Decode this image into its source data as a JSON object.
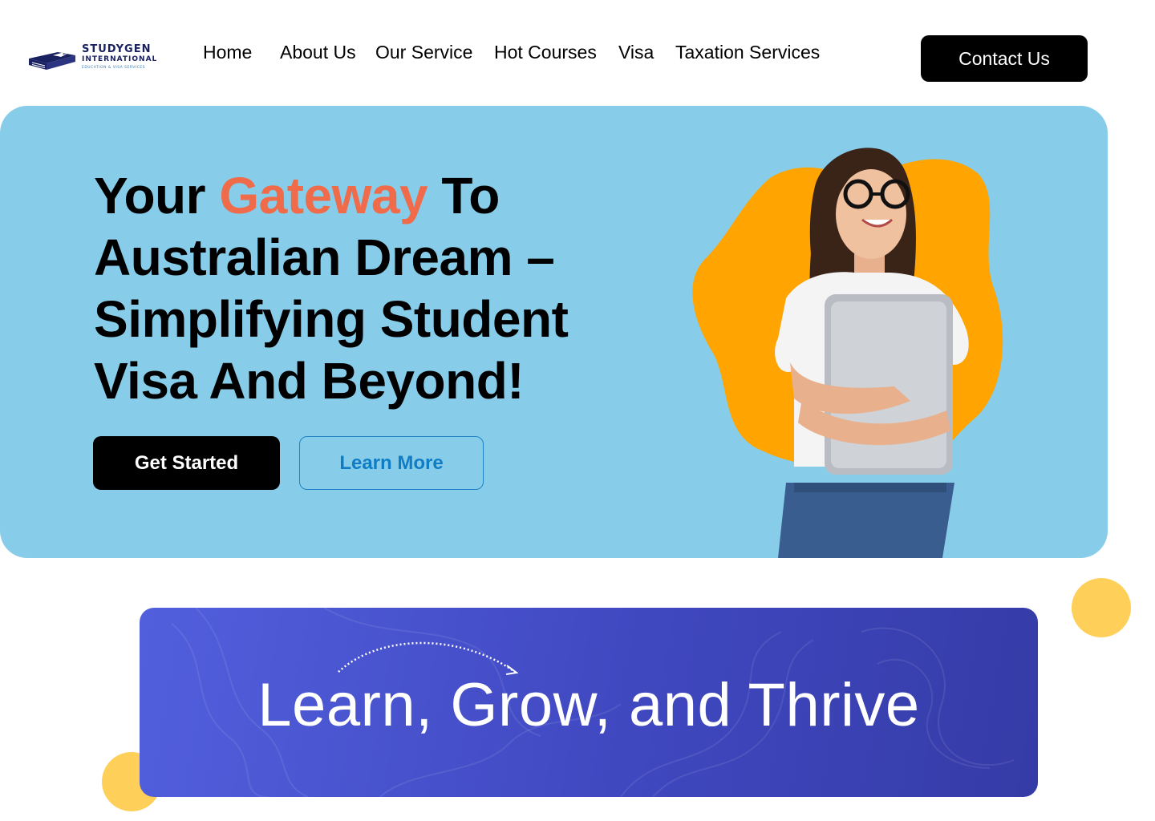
{
  "brand": {
    "name": "STUDYGEN",
    "sub": "INTERNATIONAL",
    "tagline": "Education & Visa Services",
    "icon": "book-plane-logo-icon"
  },
  "nav": {
    "items": [
      {
        "label": "Home"
      },
      {
        "label": "About Us"
      },
      {
        "label": "Our Service"
      },
      {
        "label": "Hot Courses"
      },
      {
        "label": "Visa"
      },
      {
        "label": "Taxation Services"
      }
    ],
    "contact_label": "Contact Us"
  },
  "hero": {
    "heading_part1": "Your ",
    "heading_accent": "Gateway",
    "heading_part2": " To Australian Dream – Simplifying Student Visa And Beyond!",
    "primary_button": "Get Started",
    "secondary_button": "Learn More",
    "image": "student-with-laptop-illustration"
  },
  "banner": {
    "title": "Learn, Grow, and Thrive",
    "icon": "dotted-arrow-icon"
  },
  "colors": {
    "hero_bg": "#87cde9",
    "accent": "#ef6b4a",
    "banner_start": "#525fdd",
    "banner_end": "#353ba6",
    "blob": "#ffa400",
    "dots": "#fecf59"
  }
}
